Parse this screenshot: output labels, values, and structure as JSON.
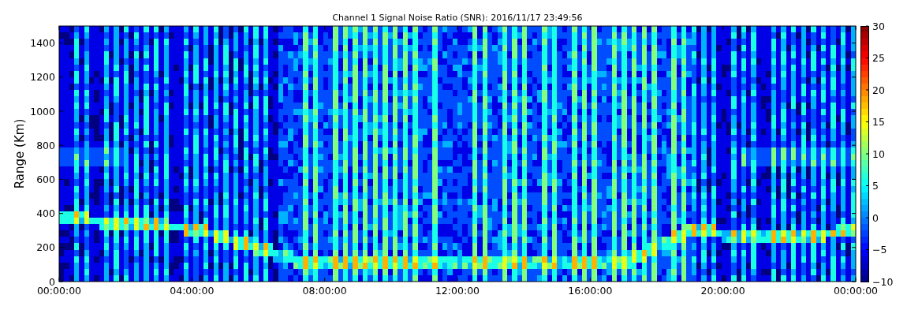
{
  "chart": {
    "title": "Channel 1 Signal Noise Ratio (SNR): 2016/11/17 23:49:56",
    "ylabel": "Range (Km)",
    "yticks": [
      "1400",
      "1200",
      "1000",
      "800",
      "600",
      "400",
      "200",
      "0"
    ],
    "xticks": [
      "00:00:00",
      "04:00:00",
      "08:00:00",
      "12:00:00",
      "16:00:00",
      "20:00:00",
      "00:00:00"
    ],
    "colorbar_ticks": [
      "30",
      "25",
      "20",
      "15",
      "10",
      "5",
      "0",
      "−5",
      "−10"
    ]
  }
}
